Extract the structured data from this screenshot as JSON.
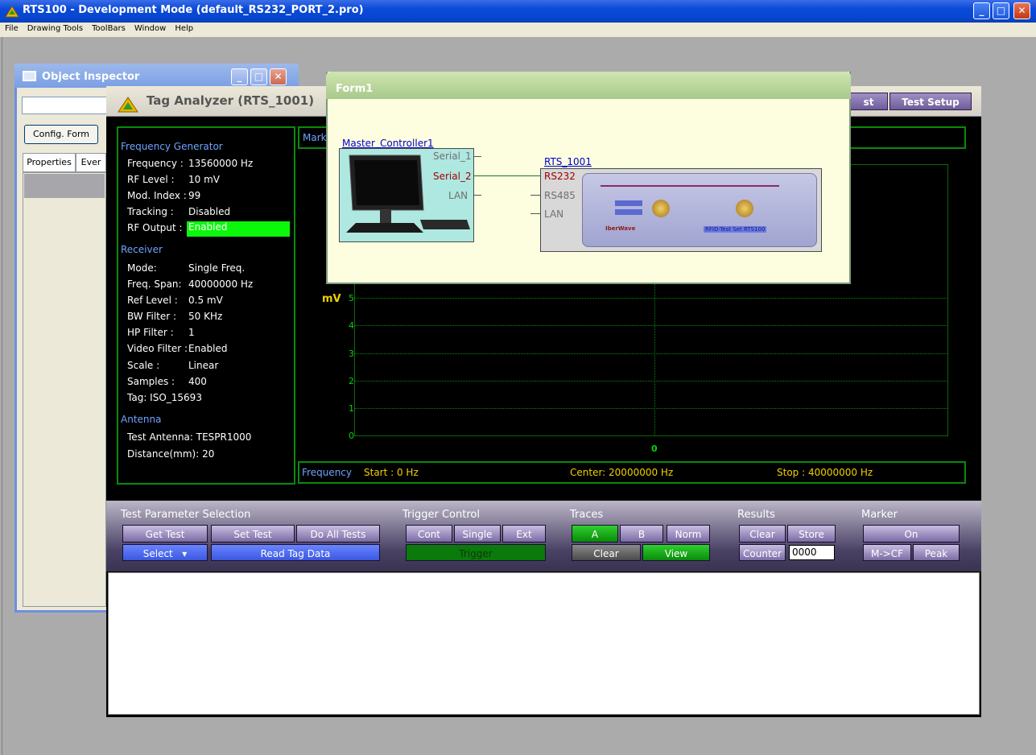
{
  "window": {
    "title": "RTS100 - Development Mode (default_RS232_PORT_2.pro)"
  },
  "menu": [
    "File",
    "Drawing Tools",
    "ToolBars",
    "Window",
    "Help"
  ],
  "object_inspector": {
    "title": "Object Inspector",
    "config_button": "Config. Form",
    "tabs": [
      "Properties",
      "Ever"
    ]
  },
  "tag_analyzer": {
    "title": "Tag Analyzer (RTS_1001)",
    "buttons": [
      "st",
      "Test Setup"
    ],
    "frequency_generator": {
      "heading": "Frequency Generator",
      "rows": [
        {
          "label": "Frequency :",
          "value": "13560000 Hz"
        },
        {
          "label": "RF Level :",
          "value": "10 mV"
        },
        {
          "label": "Mod. Index :",
          "value": "99"
        },
        {
          "label": "Tracking :",
          "value": "Disabled"
        },
        {
          "label": "RF Output :",
          "value": "Enabled"
        }
      ]
    },
    "receiver": {
      "heading": "Receiver",
      "rows": [
        {
          "label": "Mode:",
          "value": "Single Freq."
        },
        {
          "label": "Freq. Span:",
          "value": "40000000 Hz"
        },
        {
          "label": "Ref Level :",
          "value": "0.5 mV"
        },
        {
          "label": "BW Filter :",
          "value": "50 KHz"
        },
        {
          "label": "HP Filter :",
          "value": "1"
        },
        {
          "label": "Video Filter :",
          "value": "Enabled"
        },
        {
          "label": "Scale :",
          "value": "Linear"
        },
        {
          "label": "Samples :",
          "value": "400"
        }
      ],
      "tag": "Tag: ISO_15693"
    },
    "antenna": {
      "heading": "Antenna",
      "test_antenna": "Test Antenna: TESPR1000",
      "distance": "Distance(mm): 20"
    },
    "marker_label": "Mark",
    "plot": {
      "y_unit": "mV",
      "y_ticks": [
        "5",
        "4",
        "3",
        "2",
        "1",
        "0"
      ],
      "x_tick": "0"
    },
    "frequency_bar": {
      "label": "Frequency",
      "start": "Start : 0 Hz",
      "center": "Center: 20000000 Hz",
      "stop": "Stop : 40000000 Hz"
    }
  },
  "controls": {
    "test_parameter": {
      "heading": "Test Parameter Selection",
      "get_test": "Get Test",
      "set_test": "Set Test",
      "do_all": "Do All Tests",
      "select": "Select",
      "read_tag": "Read Tag Data"
    },
    "trigger": {
      "heading": "Trigger Control",
      "cont": "Cont",
      "single": "Single",
      "ext": "Ext",
      "trigger": "Trigger"
    },
    "traces": {
      "heading": "Traces",
      "a": "A",
      "b": "B",
      "norm": "Norm",
      "clear": "Clear",
      "view": "View"
    },
    "results": {
      "heading": "Results",
      "clear": "Clear",
      "store": "Store",
      "counter": "Counter",
      "counter_value": "0000"
    },
    "marker": {
      "heading": "Marker",
      "on": "On",
      "mcf": "M->CF",
      "peak": "Peak"
    }
  },
  "form1": {
    "title": "Form1",
    "master": "Master_Controller1",
    "master_ports": [
      "Serial_1",
      "Serial_2",
      "LAN"
    ],
    "device": "RTS_1001",
    "device_ports": [
      "RS232",
      "RS485",
      "LAN"
    ],
    "device_panel": {
      "brand": "IberWave",
      "model": "RFID-Test Set  RTS100"
    }
  },
  "colors": {
    "green_accent": "#0bf80b",
    "chart_green": "#0a8a0a",
    "link_blue": "#0000c8"
  }
}
